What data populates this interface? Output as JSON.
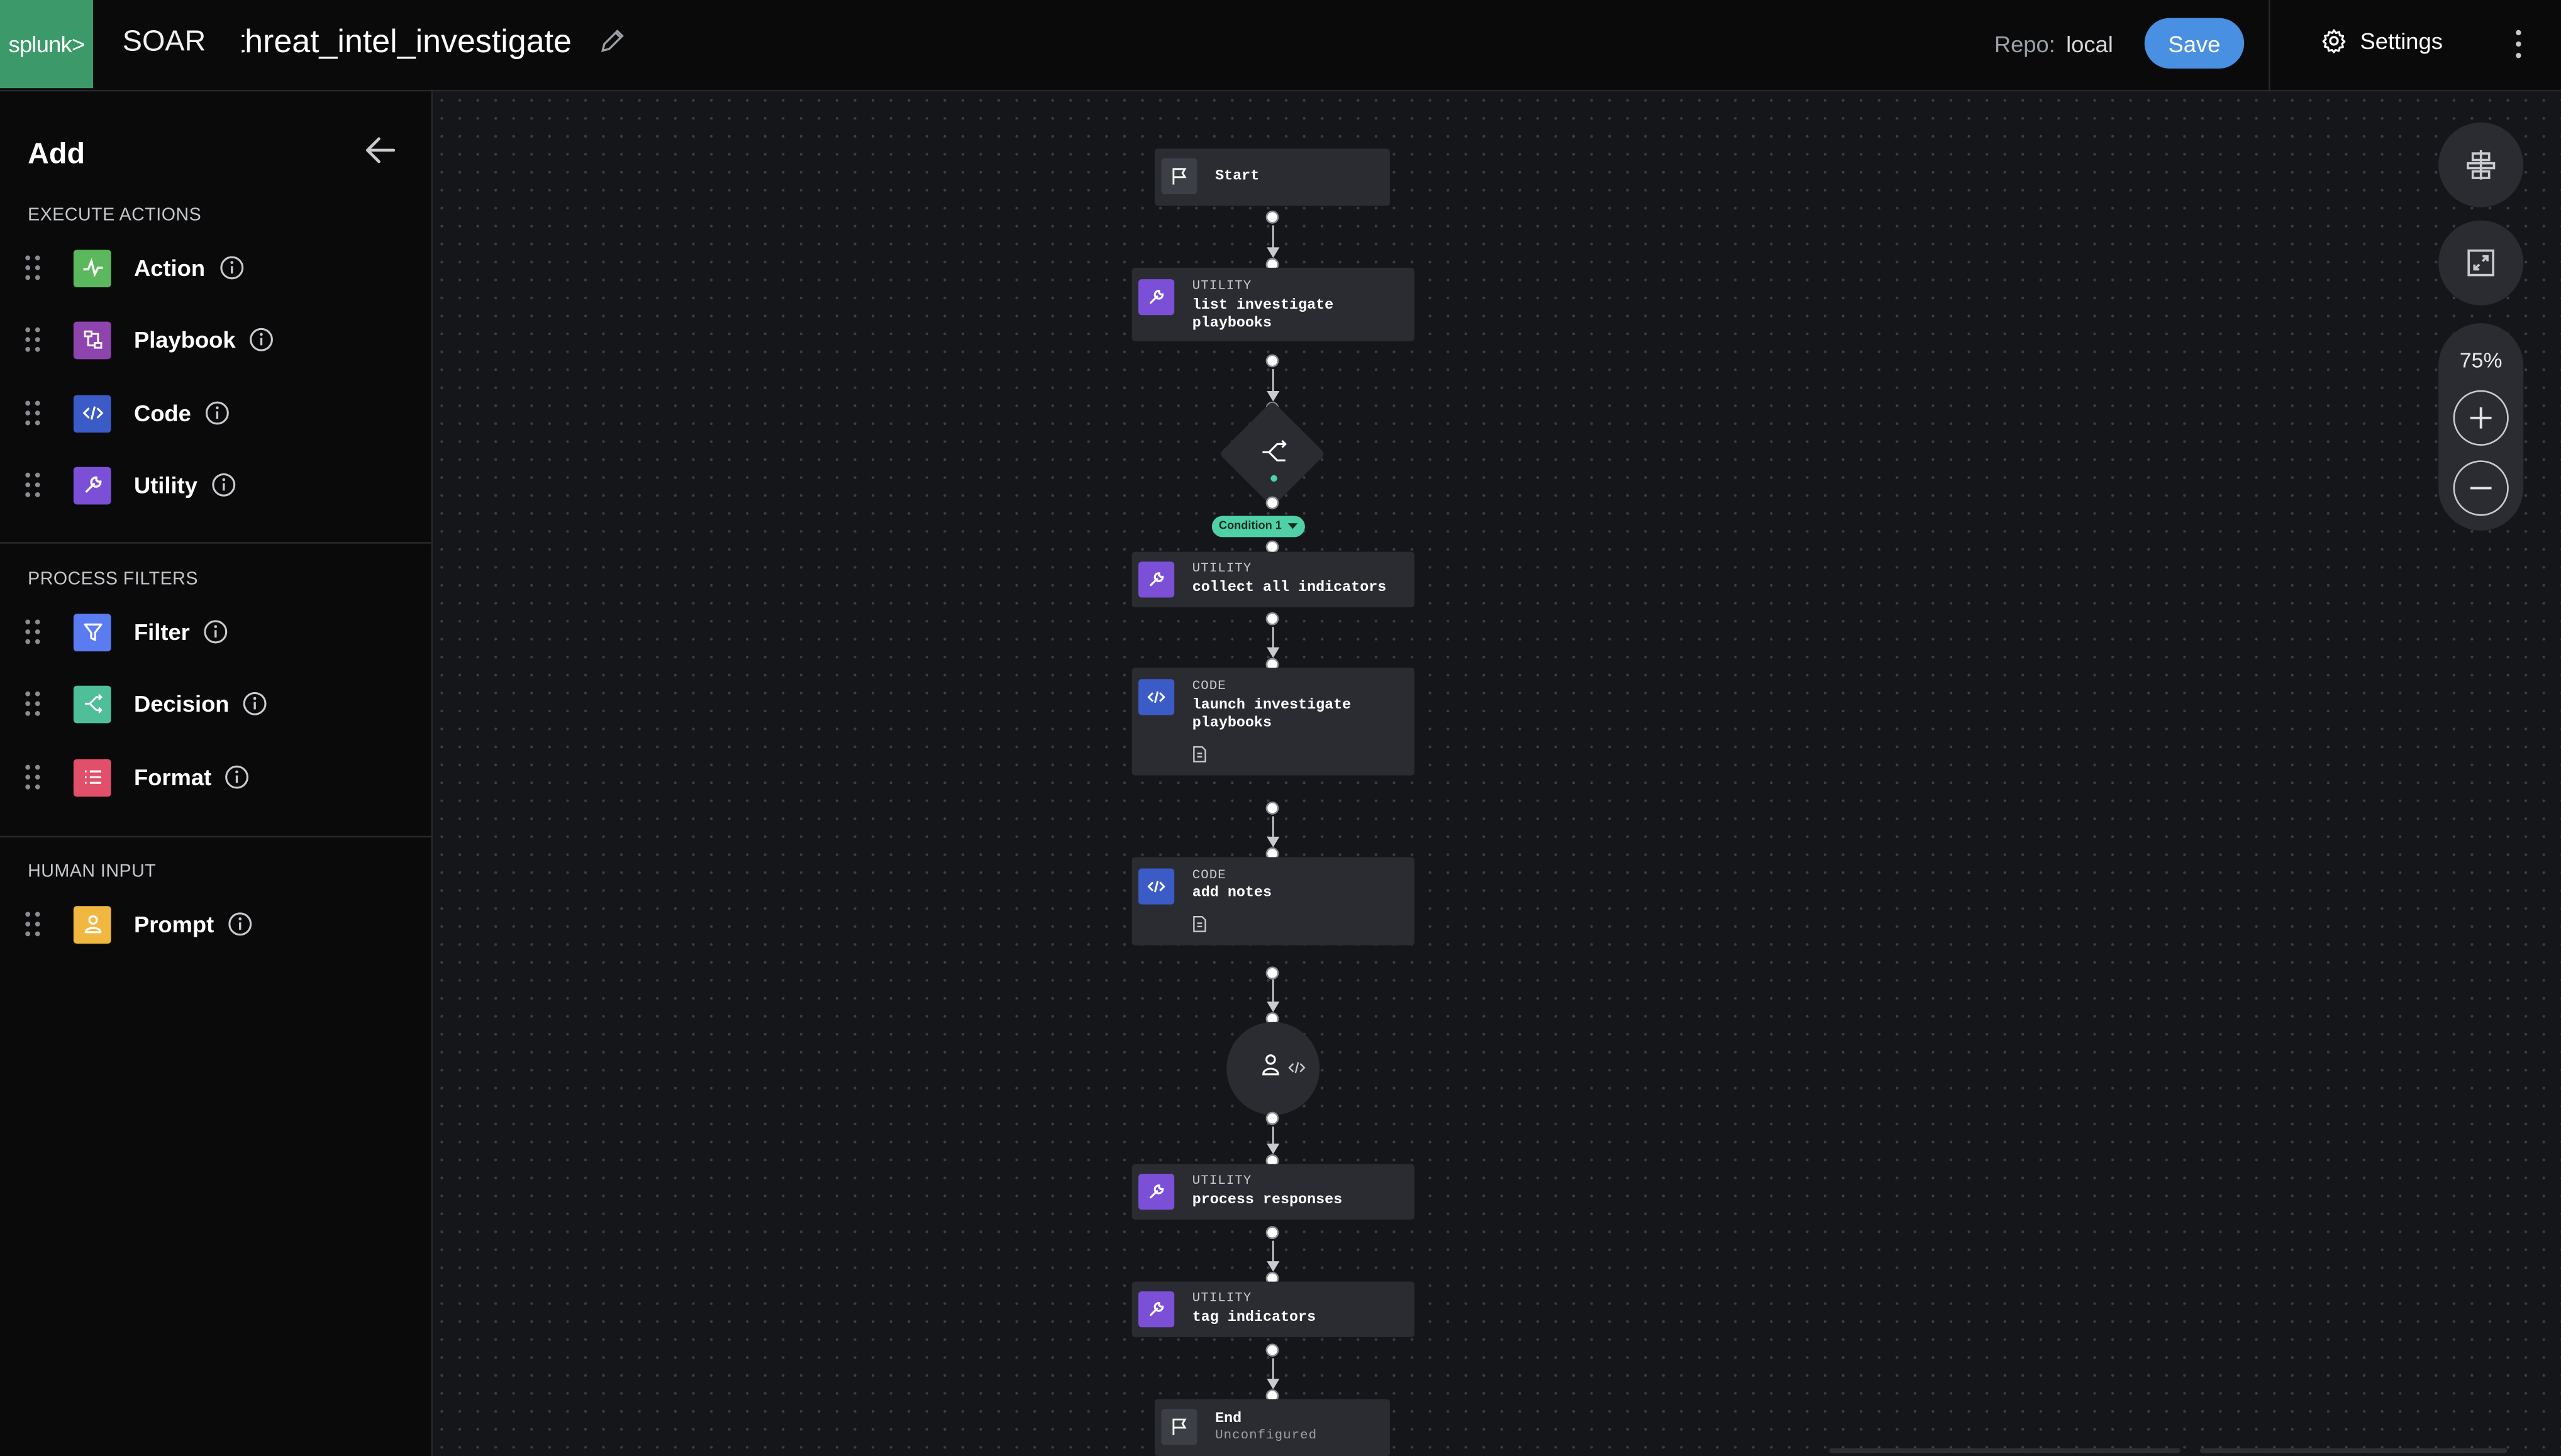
{
  "header": {
    "logo_text": "splunk>",
    "app_name": "SOAR",
    "playbook_name": "threat_intel_investigate",
    "repo_label": "Repo:",
    "repo_value": "local",
    "save_label": "Save",
    "settings_label": "Settings"
  },
  "sidebar": {
    "title": "Add",
    "sections": [
      {
        "title": "EXECUTE ACTIONS"
      },
      {
        "title": "PROCESS FILTERS"
      },
      {
        "title": "HUMAN INPUT"
      }
    ],
    "items": [
      {
        "label": "Action",
        "icon": "action-icon",
        "color": "#5cb85c"
      },
      {
        "label": "Playbook",
        "icon": "playbook-icon",
        "color": "#8e44ad"
      },
      {
        "label": "Code",
        "icon": "code-icon",
        "color": "#3b5bc7"
      },
      {
        "label": "Utility",
        "icon": "utility-icon",
        "color": "#7b4fd6"
      },
      {
        "label": "Filter",
        "icon": "filter-icon",
        "color": "#5b7cf0"
      },
      {
        "label": "Decision",
        "icon": "decision-icon",
        "color": "#4fbf9a"
      },
      {
        "label": "Format",
        "icon": "format-icon",
        "color": "#e0506a"
      },
      {
        "label": "Prompt",
        "icon": "prompt-icon",
        "color": "#f0b840"
      }
    ]
  },
  "flow": {
    "start": {
      "name": "Start"
    },
    "nodes": [
      {
        "type": "UTILITY",
        "name": "list investigate\nplaybooks"
      },
      {
        "type": "UTILITY",
        "name": "collect all indicators"
      },
      {
        "type": "CODE",
        "name": "launch investigate\nplaybooks"
      },
      {
        "type": "CODE",
        "name": "add notes"
      },
      {
        "type": "UTILITY",
        "name": "process responses"
      },
      {
        "type": "UTILITY",
        "name": "tag indicators"
      }
    ],
    "condition_label": "Condition 1",
    "end": {
      "name": "End",
      "status": "Unconfigured"
    }
  },
  "zoom": {
    "level": "75%"
  },
  "colors": {
    "accent": "#4a90e2",
    "utility": "#7b4fd6",
    "code": "#3b5bc7",
    "decision": "#4fd1a5",
    "brand": "#3c9a6a"
  }
}
